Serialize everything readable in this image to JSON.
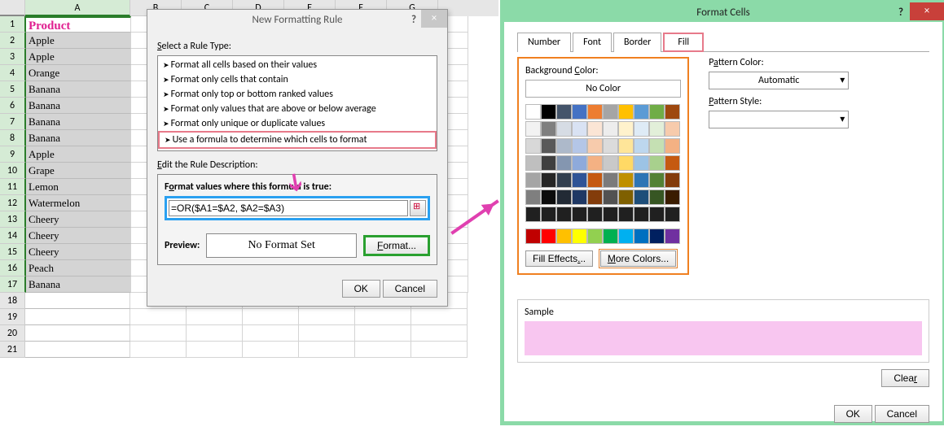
{
  "columns": [
    "A",
    "B",
    "C",
    "D",
    "E",
    "F",
    "G"
  ],
  "rows": [
    {
      "n": 1,
      "a": "Product",
      "hdr": true
    },
    {
      "n": 2,
      "a": "Apple"
    },
    {
      "n": 3,
      "a": "Apple"
    },
    {
      "n": 4,
      "a": "Orange"
    },
    {
      "n": 5,
      "a": "Banana"
    },
    {
      "n": 6,
      "a": "Banana"
    },
    {
      "n": 7,
      "a": "Banana"
    },
    {
      "n": 8,
      "a": "Banana"
    },
    {
      "n": 9,
      "a": "Apple"
    },
    {
      "n": 10,
      "a": "Grape"
    },
    {
      "n": 11,
      "a": "Lemon"
    },
    {
      "n": 12,
      "a": "Watermelon"
    },
    {
      "n": 13,
      "a": "Cheery"
    },
    {
      "n": 14,
      "a": "Cheery"
    },
    {
      "n": 15,
      "a": "Cheery"
    },
    {
      "n": 16,
      "a": "Peach"
    },
    {
      "n": 17,
      "a": "Banana"
    },
    {
      "n": 18,
      "a": ""
    },
    {
      "n": 19,
      "a": ""
    },
    {
      "n": 20,
      "a": ""
    },
    {
      "n": 21,
      "a": ""
    }
  ],
  "dlg1": {
    "title": "New Formatting Rule",
    "select_label": "Select a Rule Type:",
    "rules": [
      "Format all cells based on their values",
      "Format only cells that contain",
      "Format only top or bottom ranked values",
      "Format only values that are above or below average",
      "Format only unique or duplicate values",
      "Use a formula to determine which cells to format"
    ],
    "edit_label": "Edit the Rule Description:",
    "formula_label": "Format values where this formula is true:",
    "formula": "=OR($A1=$A2, $A2=$A3)",
    "preview_label": "Preview:",
    "preview_text": "No Format Set",
    "format_btn": "Format...",
    "ok": "OK",
    "cancel": "Cancel",
    "help": "?"
  },
  "dlg2": {
    "title": "Format Cells",
    "tabs": [
      "Number",
      "Font",
      "Border",
      "Fill"
    ],
    "bg_label": "Background Color:",
    "nocolor": "No Color",
    "fill_effects": "Fill Effects...",
    "more_colors": "More Colors...",
    "pattern_color": "Pattern Color:",
    "automatic": "Automatic",
    "pattern_style": "Pattern Style:",
    "sample": "Sample",
    "clear": "Clear",
    "ok": "OK",
    "cancel": "Cancel",
    "help": "?",
    "theme_colors": [
      "#ffffff",
      "#000000",
      "#44546a",
      "#4472c4",
      "#ed7d31",
      "#a5a5a5",
      "#ffc000",
      "#5b9bd5",
      "#70ad47",
      "#9e480e",
      "#f2f2f2",
      "#7f7f7f",
      "#d6dce4",
      "#d9e2f3",
      "#fbe5d5",
      "#ededed",
      "#fff2cc",
      "#deebf6",
      "#e2efd9",
      "#f7cbac",
      "#d8d8d8",
      "#595959",
      "#adb9ca",
      "#b4c6e7",
      "#f7cbac",
      "#dbdbdb",
      "#fee599",
      "#bdd7ee",
      "#c5e0b3",
      "#f4b183",
      "#bfbfbf",
      "#3f3f3f",
      "#8496b0",
      "#8eaadb",
      "#f4b183",
      "#c9c9c9",
      "#ffd965",
      "#9cc3e5",
      "#a8d08d",
      "#c55a11",
      "#a5a5a5",
      "#262626",
      "#323f4f",
      "#2f5496",
      "#c55a11",
      "#7b7b7b",
      "#bf9000",
      "#2e75b5",
      "#538135",
      "#833c0b",
      "#7f7f7f",
      "#0c0c0c",
      "#222a35",
      "#1f3864",
      "#833c0b",
      "#525252",
      "#7f6000",
      "#1e4e79",
      "#375623",
      "#3a1c00",
      "#202020",
      "#202020",
      "#202020",
      "#202020",
      "#202020",
      "#202020",
      "#202020",
      "#202020",
      "#202020",
      "#202020"
    ],
    "standard_colors": [
      "#c00000",
      "#ff0000",
      "#ffc000",
      "#ffff00",
      "#92d050",
      "#00b050",
      "#00b0f0",
      "#0070c0",
      "#002060",
      "#7030a0"
    ]
  }
}
